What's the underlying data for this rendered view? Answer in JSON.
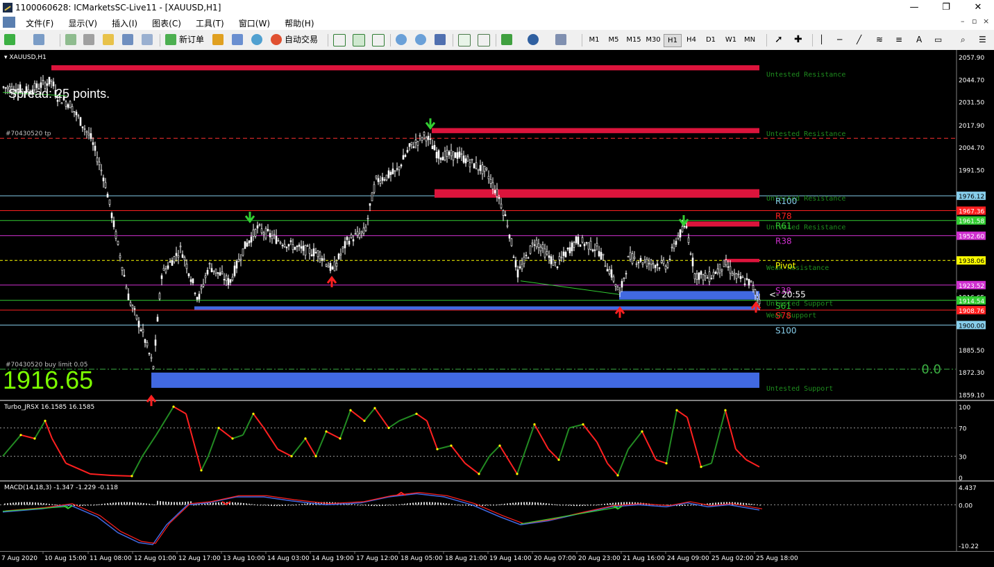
{
  "window": {
    "title": "1100060628: ICMarketsSC-Live11 - [XAUUSD,H1]",
    "minimize": "—",
    "restore": "❐",
    "close": "✕"
  },
  "menu": [
    "文件(F)",
    "显示(V)",
    "插入(I)",
    "图表(C)",
    "工具(T)",
    "窗口(W)",
    "帮助(H)"
  ],
  "toolbar": {
    "new_order": "新订单",
    "auto_trading": "自动交易",
    "timeframes": [
      "M1",
      "M5",
      "M15",
      "M30",
      "H1",
      "H4",
      "D1",
      "W1",
      "MN"
    ],
    "active_timeframe": "H1"
  },
  "chart": {
    "symbol_label": "XAUUSD,H1",
    "spread_text": "Spread: 25 points.",
    "big_price": "1916.65",
    "order_tp_label": "#70430520 tp",
    "order_buy_limit_label": "#70430520 buy limit 0.05",
    "zero_label": "0.0",
    "countdown": "<- 20:55",
    "price_axis": [
      "2057.90",
      "2044.70",
      "2031.50",
      "2017.90",
      "2004.70",
      "1991.50",
      "1976.12",
      "1967.36",
      "1961.58",
      "1952.60",
      "1938.06",
      "1923.52",
      "1916.65",
      "1914.54",
      "1908.76",
      "1900.00",
      "1885.50",
      "1872.30",
      "1859.10"
    ],
    "zones": [
      {
        "label": "Untested Resistance"
      },
      {
        "label": "Untested Resistance"
      },
      {
        "label": "Untested Resistance"
      },
      {
        "label": "Untested Resistance"
      },
      {
        "label": "Weak Resistance"
      },
      {
        "label": "Untested Support"
      },
      {
        "label": "Weak Support"
      },
      {
        "label": "Untested Support"
      }
    ],
    "levels": [
      {
        "label": "R100",
        "price": "1976.12",
        "color": "#87ceeb"
      },
      {
        "label": "R78",
        "price": "1967.36",
        "color": "#ff2020"
      },
      {
        "label": "R61",
        "price": "1961.58",
        "color": "#32cd32"
      },
      {
        "label": "R38",
        "price": "1952.60",
        "color": "#d030d0"
      },
      {
        "label": "Pivot",
        "price": "1938.06",
        "color": "#ffff00"
      },
      {
        "label": "S38",
        "price": "1923.52",
        "color": "#d030d0"
      },
      {
        "label": "S61",
        "price": "1914.54",
        "color": "#32cd32"
      },
      {
        "label": "S78",
        "price": "1908.76",
        "color": "#ff2020"
      },
      {
        "label": "S100",
        "price": "1900.00",
        "color": "#87ceeb"
      }
    ]
  },
  "indicator1": {
    "label": "Turbo_JRSX 16.1585 16.1585",
    "axis": [
      "100",
      "70",
      "30",
      "0"
    ]
  },
  "indicator2": {
    "label": "MACD(14,18,3) -1.347 -1.229 -0.118",
    "axis": [
      "4.437",
      "0.00",
      "-10.22"
    ]
  },
  "time_axis": [
    "7 Aug 2020",
    "10 Aug 15:00",
    "11 Aug 08:00",
    "12 Aug 01:00",
    "12 Aug 17:00",
    "13 Aug 10:00",
    "14 Aug 03:00",
    "14 Aug 19:00",
    "17 Aug 12:00",
    "18 Aug 05:00",
    "18 Aug 21:00",
    "19 Aug 14:00",
    "20 Aug 07:00",
    "20 Aug 23:00",
    "21 Aug 16:00",
    "24 Aug 09:00",
    "25 Aug 02:00",
    "25 Aug 18:00"
  ],
  "colors": {
    "background": "#000000",
    "resistance_zone": "#dc143c",
    "support_zone": "#4169e1",
    "zone_text": "#1e8c1e",
    "indicator_up": "#228b22",
    "indicator_down": "#ff2020",
    "indicator_turn": "#ffff00"
  }
}
